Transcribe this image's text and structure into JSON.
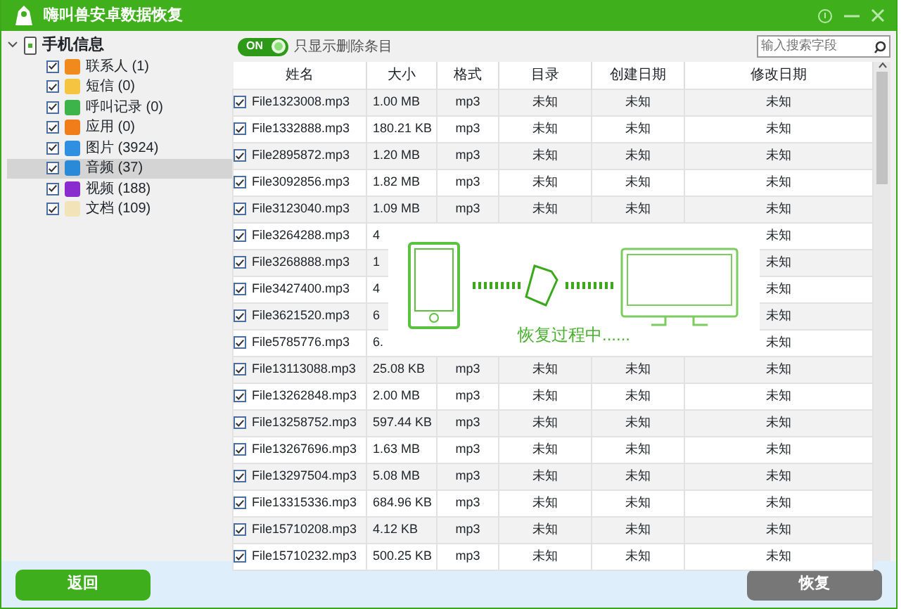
{
  "window": {
    "title": "嗨叫兽安卓数据恢复"
  },
  "sidebar": {
    "root": {
      "label": "手机信息",
      "expanded": true,
      "children": [
        {
          "label": "联系人 (1)",
          "checked": true,
          "selected": false,
          "color": "#f08a1c"
        },
        {
          "label": "短信 (0)",
          "checked": true,
          "selected": false,
          "color": "#f5c542"
        },
        {
          "label": "呼叫记录 (0)",
          "checked": true,
          "selected": false,
          "color": "#3cb44a"
        },
        {
          "label": "应用 (0)",
          "checked": true,
          "selected": false,
          "color": "#f07d1a"
        },
        {
          "label": "图片 (3924)",
          "checked": true,
          "selected": false,
          "color": "#2f8fe0"
        },
        {
          "label": "音频 (37)",
          "checked": true,
          "selected": true,
          "color": "#2a8ad8"
        },
        {
          "label": "视频 (188)",
          "checked": true,
          "selected": false,
          "color": "#8a2bd0"
        },
        {
          "label": "文档 (109)",
          "checked": true,
          "selected": false,
          "color": "#f3e3b8"
        }
      ]
    }
  },
  "toolbar": {
    "toggle": {
      "label": "ON",
      "on": true
    },
    "toggle_caption": "只显示删除条目",
    "search": {
      "placeholder": "输入搜索字段"
    }
  },
  "table": {
    "columns": [
      "姓名",
      "大小",
      "格式",
      "目录",
      "创建日期",
      "修改日期"
    ],
    "rows": [
      {
        "checked": true,
        "cells": [
          "File1323008.mp3",
          "1.00 MB",
          "mp3",
          "未知",
          "未知",
          "未知"
        ]
      },
      {
        "checked": true,
        "cells": [
          "File1332888.mp3",
          "180.21 KB",
          "mp3",
          "未知",
          "未知",
          "未知"
        ]
      },
      {
        "checked": true,
        "cells": [
          "File2895872.mp3",
          "1.20 MB",
          "mp3",
          "未知",
          "未知",
          "未知"
        ]
      },
      {
        "checked": true,
        "cells": [
          "File3092856.mp3",
          "1.82 MB",
          "mp3",
          "未知",
          "未知",
          "未知"
        ]
      },
      {
        "checked": true,
        "cells": [
          "File3123040.mp3",
          "1.09 MB",
          "mp3",
          "未知",
          "未知",
          "未知"
        ]
      },
      {
        "checked": true,
        "cells": [
          "File3264288.mp3",
          "4",
          null,
          null,
          null,
          "未知"
        ]
      },
      {
        "checked": true,
        "cells": [
          "File3268888.mp3",
          "1",
          null,
          null,
          null,
          "未知"
        ]
      },
      {
        "checked": true,
        "cells": [
          "File3427400.mp3",
          "4",
          null,
          null,
          null,
          "未知"
        ]
      },
      {
        "checked": true,
        "cells": [
          "File3621520.mp3",
          "6",
          null,
          null,
          null,
          "未知"
        ]
      },
      {
        "checked": true,
        "cells": [
          "File5785776.mp3",
          "6.",
          null,
          null,
          null,
          "未知"
        ]
      },
      {
        "checked": true,
        "cells": [
          "File13113088.mp3",
          "25.08 KB",
          "mp3",
          "未知",
          "未知",
          "未知"
        ]
      },
      {
        "checked": true,
        "cells": [
          "File13262848.mp3",
          "2.00 MB",
          "mp3",
          "未知",
          "未知",
          "未知"
        ]
      },
      {
        "checked": true,
        "cells": [
          "File13258752.mp3",
          "597.44 KB",
          "mp3",
          "未知",
          "未知",
          "未知"
        ]
      },
      {
        "checked": true,
        "cells": [
          "File13267696.mp3",
          "1.63 MB",
          "mp3",
          "未知",
          "未知",
          "未知"
        ]
      },
      {
        "checked": true,
        "cells": [
          "File13297504.mp3",
          "5.08 MB",
          "mp3",
          "未知",
          "未知",
          "未知"
        ]
      },
      {
        "checked": true,
        "cells": [
          "File13315336.mp3",
          "684.96 KB",
          "mp3",
          "未知",
          "未知",
          "未知"
        ]
      },
      {
        "checked": true,
        "cells": [
          "File15710208.mp3",
          "4.12 KB",
          "mp3",
          "未知",
          "未知",
          "未知"
        ]
      },
      {
        "checked": true,
        "cells": [
          "File15710232.mp3",
          "500.25 KB",
          "mp3",
          "未知",
          "未知",
          "未知"
        ]
      }
    ]
  },
  "progress_dialog": {
    "message": "恢复过程中......"
  },
  "buttons": [
    {
      "label": "返回",
      "kind": "primary"
    },
    {
      "label": "恢复",
      "kind": "secondary"
    }
  ]
}
